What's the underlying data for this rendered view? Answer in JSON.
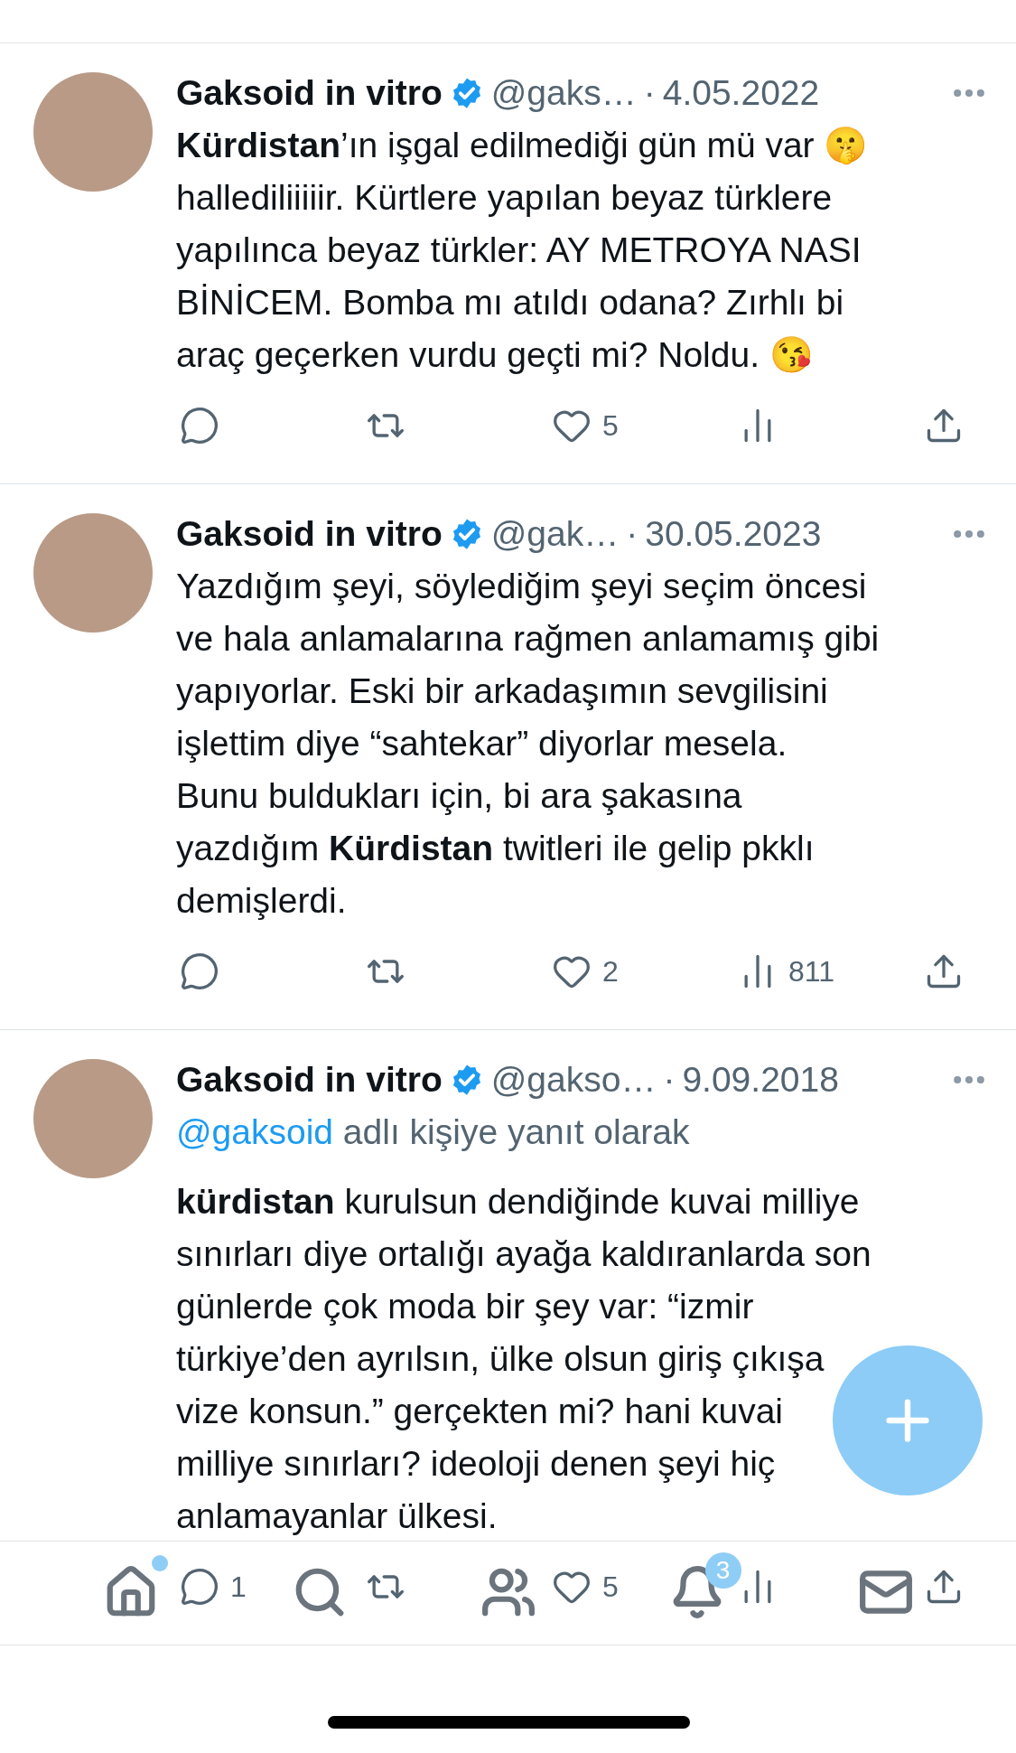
{
  "tweets": [
    {
      "author": "Gaksoid in vitro",
      "verified": true,
      "handle": "@gaks…",
      "separator": "·",
      "date": "4.05.2022",
      "lines": [
        "**Kürdistan**’ın işgal edilmediği gün mü var 🤫",
        "hallediliiiiir. Kürtlere yapılan beyaz türklere",
        "yapılınca beyaz türkler: AY METROYA NASI",
        "BİNİCEM. Bomba mı atıldı odana? Zırhlı bi",
        "araç geçerken vurdu geçti mi? Noldu. 😘"
      ],
      "actions": [
        {
          "kind": "reply"
        },
        {
          "kind": "repost"
        },
        {
          "kind": "like",
          "count": "5"
        },
        {
          "kind": "views"
        },
        {
          "kind": "share"
        }
      ]
    },
    {
      "author": "Gaksoid in vitro",
      "verified": true,
      "handle": "@gak…",
      "separator": "·",
      "date": "30.05.2023",
      "lines": [
        "Yazdığım şeyi, söylediğim şeyi seçim öncesi",
        "ve hala anlamalarına rağmen anlamamış gibi",
        "yapıyorlar. Eski bir arkadaşımın sevgilisini",
        "işlettim diye “sahtekar” diyorlar mesela.",
        "Bunu buldukları için, bi ara şakasına",
        "yazdığım **Kürdistan** twitleri ile gelip pkklı",
        "demişlerdi."
      ],
      "actions": [
        {
          "kind": "reply"
        },
        {
          "kind": "repost"
        },
        {
          "kind": "like",
          "count": "2"
        },
        {
          "kind": "views",
          "count": "811"
        },
        {
          "kind": "share"
        }
      ]
    },
    {
      "author": "Gaksoid in vitro",
      "verified": true,
      "handle": "@gakso…",
      "separator": "·",
      "date": "9.09.2018",
      "reply_to": {
        "mention": "@gaksoid",
        "text": "adlı kişiye yanıt olarak"
      },
      "lines": [
        "**kürdistan** kurulsun dendiğinde kuvai milliye",
        "sınırları diye ortalığı ayağa kaldıranlarda son",
        "günlerde çok moda bir şey var: “izmir",
        "türkiye’den ayrılsın, ülke olsun giriş çıkışa",
        "vize konsun.” gerçekten mi? hani kuvai",
        "milliye sınırları? ideoloji denen şeyi hiç",
        "anlamayanlar ülkesi."
      ],
      "actions": [
        {
          "kind": "reply",
          "count": "1"
        },
        {
          "kind": "repost"
        },
        {
          "kind": "like",
          "count": "5"
        },
        {
          "kind": "views"
        },
        {
          "kind": "share"
        }
      ]
    }
  ],
  "bottom_nav": [
    {
      "kind": "home",
      "dot": true
    },
    {
      "kind": "search"
    },
    {
      "kind": "communities"
    },
    {
      "kind": "notifications",
      "badge": "3"
    },
    {
      "kind": "messages"
    }
  ]
}
